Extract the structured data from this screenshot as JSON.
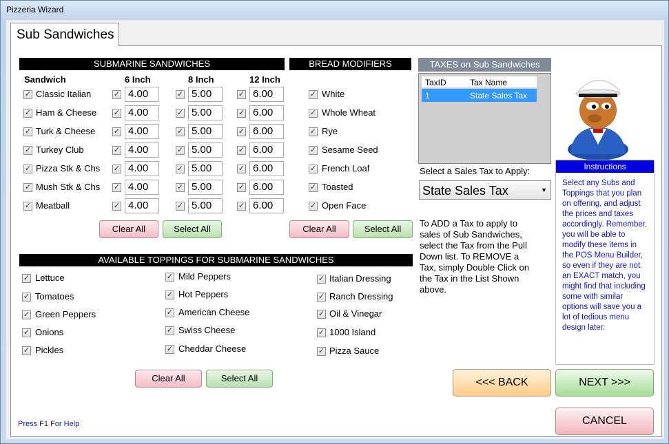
{
  "window": {
    "title": "Pizzeria Wizard",
    "tab": "Sub Sandwiches",
    "help": "Press F1 For Help"
  },
  "subs": {
    "header": "SUBMARINE SANDWICHES",
    "col_sandwich": "Sandwich",
    "col_6": "6 Inch",
    "col_8": "8 Inch",
    "col_12": "12 Inch",
    "check": "✓",
    "items": [
      {
        "name": "Classic Italian",
        "p6": "4.00",
        "p8": "5.00",
        "p12": "6.00"
      },
      {
        "name": "Ham & Cheese",
        "p6": "4.00",
        "p8": "5.00",
        "p12": "6.00"
      },
      {
        "name": "Turk & Cheese",
        "p6": "4.00",
        "p8": "5.00",
        "p12": "6.00"
      },
      {
        "name": "Turkey Club",
        "p6": "4.00",
        "p8": "5.00",
        "p12": "6.00"
      },
      {
        "name": "Pizza Stk & Chs",
        "p6": "4.00",
        "p8": "5.00",
        "p12": "6.00"
      },
      {
        "name": "Mush Stk & Chs",
        "p6": "4.00",
        "p8": "5.00",
        "p12": "6.00"
      },
      {
        "name": "Meatball",
        "p6": "4.00",
        "p8": "5.00",
        "p12": "6.00"
      }
    ],
    "clear_all": "Clear All",
    "select_all": "Select All"
  },
  "bread": {
    "header": "BREAD MODIFIERS",
    "items": [
      "White",
      "Whole Wheat",
      "Rye",
      "Sesame Seed",
      "French Loaf",
      "Toasted",
      "Open Face"
    ],
    "clear_all": "Clear All",
    "select_all": "Select All"
  },
  "toppings": {
    "header": "AVAILABLE TOPPINGS FOR SUBMARINE SANDWICHES",
    "col1": [
      "Lettuce",
      "Tomatoes",
      "Green Peppers",
      "Onions",
      "Pickles"
    ],
    "col2": [
      "Mild Peppers",
      "Hot Peppers",
      "American Cheese",
      "Swiss Cheese",
      "Cheddar Cheese"
    ],
    "col3": [
      "Italian Dressing",
      "Ranch Dressing",
      "Oil & Vinegar",
      "1000 Island",
      "Pizza Sauce"
    ],
    "clear_all": "Clear All",
    "select_all": "Select All"
  },
  "taxes": {
    "header": "TAXES on Sub Sandwiches",
    "col_id": "TaxID",
    "col_name": "Tax Name",
    "rows": [
      {
        "id": "1",
        "name": "State Sales Tax"
      }
    ],
    "select_label": "Select a Sales Tax to Apply:",
    "selected": "State Sales Tax",
    "note": "To ADD a Tax to apply to sales of Sub Sandwiches, select the Tax from the Pull Down list.  To REMOVE a Tax, simply Double Click on the Tax in the List Shown above."
  },
  "instructions": {
    "title": "Instructions",
    "text": "Select any Subs and Toppings that you plan on offering, and adjust the prices and taxes accordingly. Remember, you will be able to modify these items in the POS Menu Builder, so even if they are not an EXACT match, you might find that including some with similar options will save you a lot of tedious menu design later."
  },
  "nav": {
    "back": "<<< BACK",
    "next": "NEXT >>>",
    "cancel": "CANCEL"
  },
  "colors": {
    "instr_title_bg": "#0000e0",
    "instr_text": "#1414c8",
    "tax_header_bg": "#7f8b99",
    "tax_selected_bg": "#3399ff"
  }
}
